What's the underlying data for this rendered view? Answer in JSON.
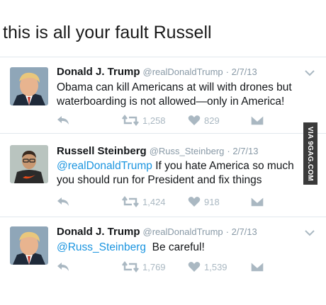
{
  "caption": "this is all your fault Russell",
  "watermark": "VIA 9GAG.COM",
  "colors": {
    "link": "#1b95e0",
    "name": "#14171a",
    "meta": "#8899a6",
    "icon": "#aab8c2"
  },
  "tweets": [
    {
      "name": "Donald J. Trump",
      "handle": "@realDonaldTrump",
      "date": "· 2/7/13",
      "mention": "",
      "text": "Obama can kill Americans at will with drones but waterboarding is not allowed—only in America!",
      "retweets": "1,258",
      "likes": "829",
      "avatar_icon": "trump-avatar"
    },
    {
      "name": "Russell Steinberg",
      "handle": "@Russ_Steinberg",
      "date": "· 2/7/13",
      "mention": "@realDonaldTrump",
      "text": "If you hate America so much you should run for President and fix things",
      "retweets": "1,424",
      "likes": "918",
      "avatar_icon": "russell-avatar"
    },
    {
      "name": "Donald J. Trump",
      "handle": "@realDonaldTrump",
      "date": "· 2/7/13",
      "mention": "@Russ_Steinberg",
      "text": "Be careful!",
      "retweets": "1,769",
      "likes": "1,539",
      "avatar_icon": "trump-avatar"
    }
  ]
}
